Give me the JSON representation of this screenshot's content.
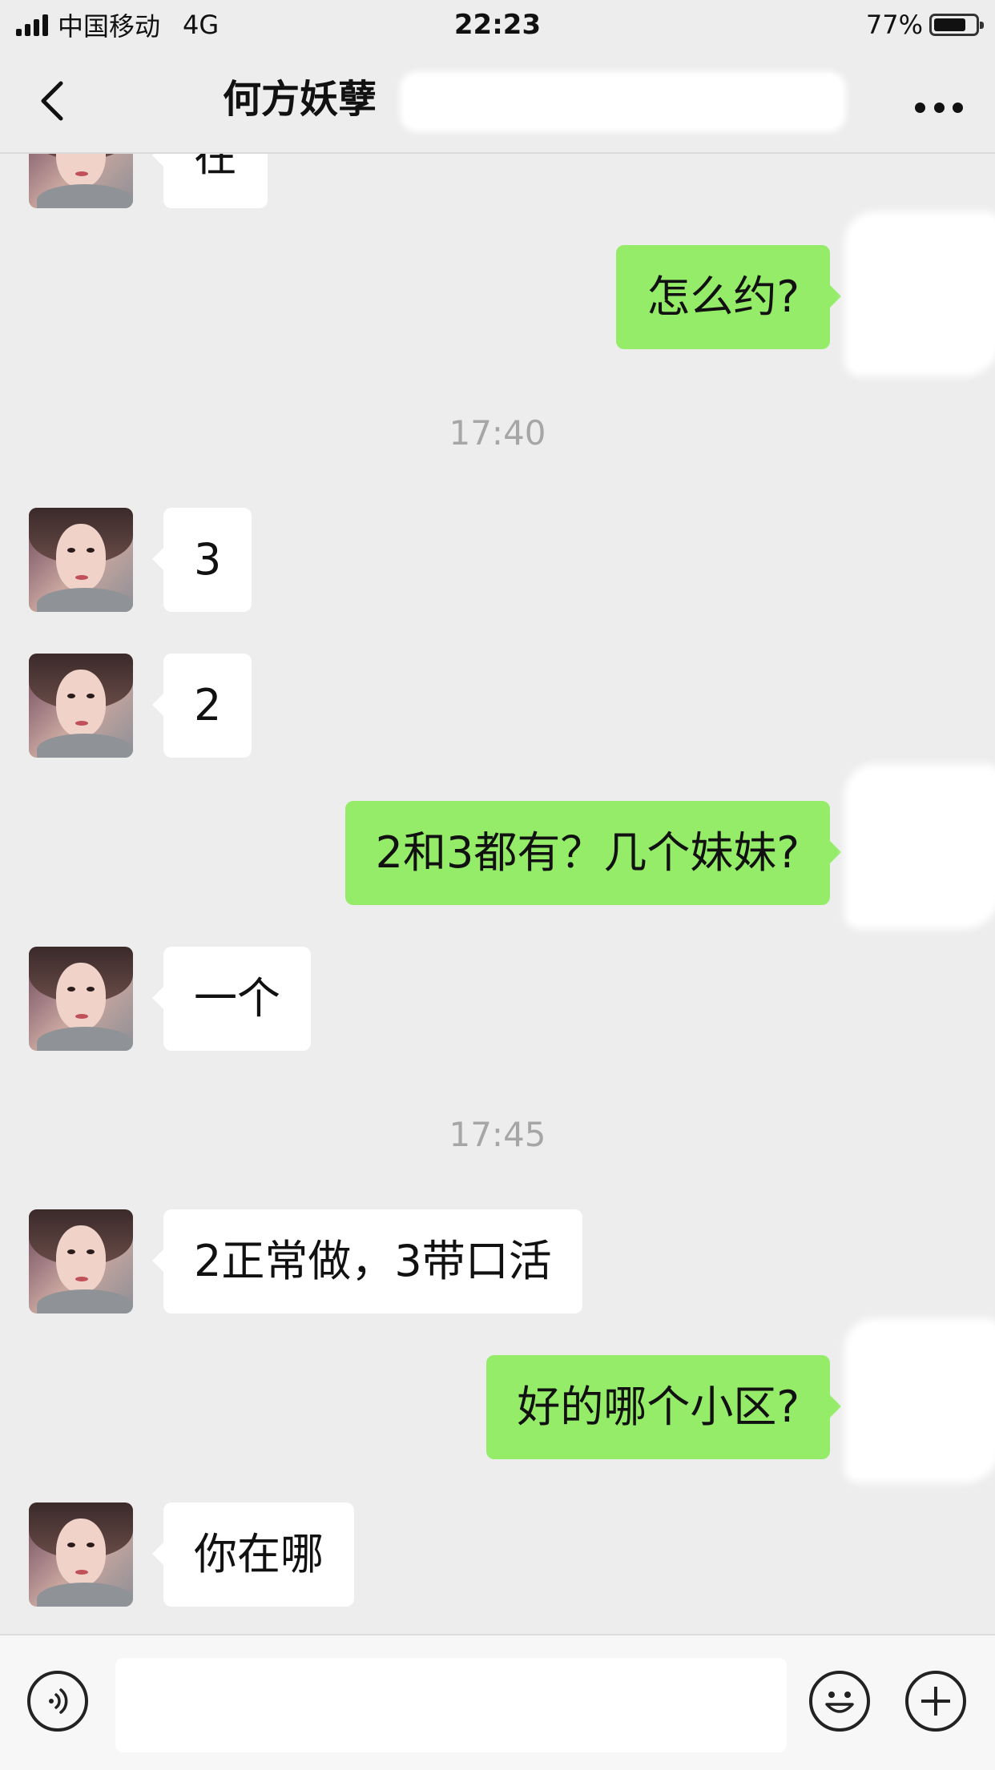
{
  "status_bar": {
    "carrier": "中国移动",
    "network": "4G",
    "time": "22:23",
    "battery_percent": "77%",
    "battery_level": 0.77
  },
  "nav": {
    "title": "何方妖孽",
    "back_icon": "chevron-left-icon",
    "more_icon": "ellipsis-icon"
  },
  "messages": [
    {
      "side": "left",
      "text": "在"
    },
    {
      "side": "right",
      "text": "怎么约?"
    },
    {
      "type": "time",
      "text": "17:40"
    },
    {
      "side": "left",
      "text": "3"
    },
    {
      "side": "left",
      "text": "2"
    },
    {
      "side": "right",
      "text": "2和3都有？几个妹妹?"
    },
    {
      "side": "left",
      "text": "一个"
    },
    {
      "type": "time",
      "text": "17:45"
    },
    {
      "side": "left",
      "text": "2正常做，3带口活"
    },
    {
      "side": "right",
      "text": "好的哪个小区?"
    },
    {
      "side": "left",
      "text": "你在哪"
    }
  ],
  "input_bar": {
    "voice_icon": "voice-icon",
    "emoji_icon": "emoji-icon",
    "plus_icon": "plus-icon",
    "input_value": ""
  },
  "colors": {
    "background": "#ededed",
    "sent_bubble": "#95ec69",
    "received_bubble": "#ffffff",
    "timestamp": "#a6a6a6"
  }
}
